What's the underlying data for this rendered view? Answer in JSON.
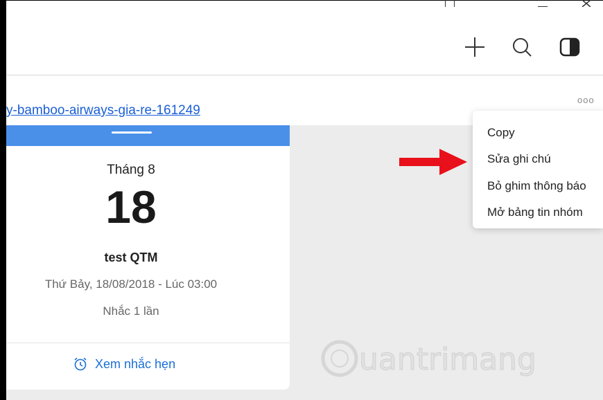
{
  "toolbar": {
    "icons": [
      "plus-icon",
      "search-icon",
      "panel-toggle-icon"
    ]
  },
  "subheader": {
    "link_text": "y-bamboo-airways-gia-re-161249",
    "more_label": "ooo"
  },
  "reminder_card": {
    "month": "Tháng 8",
    "day": "18",
    "title": "test QTM",
    "datetime": "Thứ Bảy, 18/08/2018 - Lúc 03:00",
    "repeat": "Nhắc 1 lần",
    "view_button": "Xem nhắc hẹn",
    "accent_color": "#4a90e9"
  },
  "context_menu": {
    "items": [
      {
        "label": "Copy"
      },
      {
        "label": "Sửa ghi chú"
      },
      {
        "label": "Bỏ ghim thông báo"
      },
      {
        "label": "Mở bảng tin nhóm"
      }
    ]
  },
  "annotation": {
    "arrow_color": "#e8101a"
  },
  "watermark": {
    "text": "uantrimang"
  }
}
